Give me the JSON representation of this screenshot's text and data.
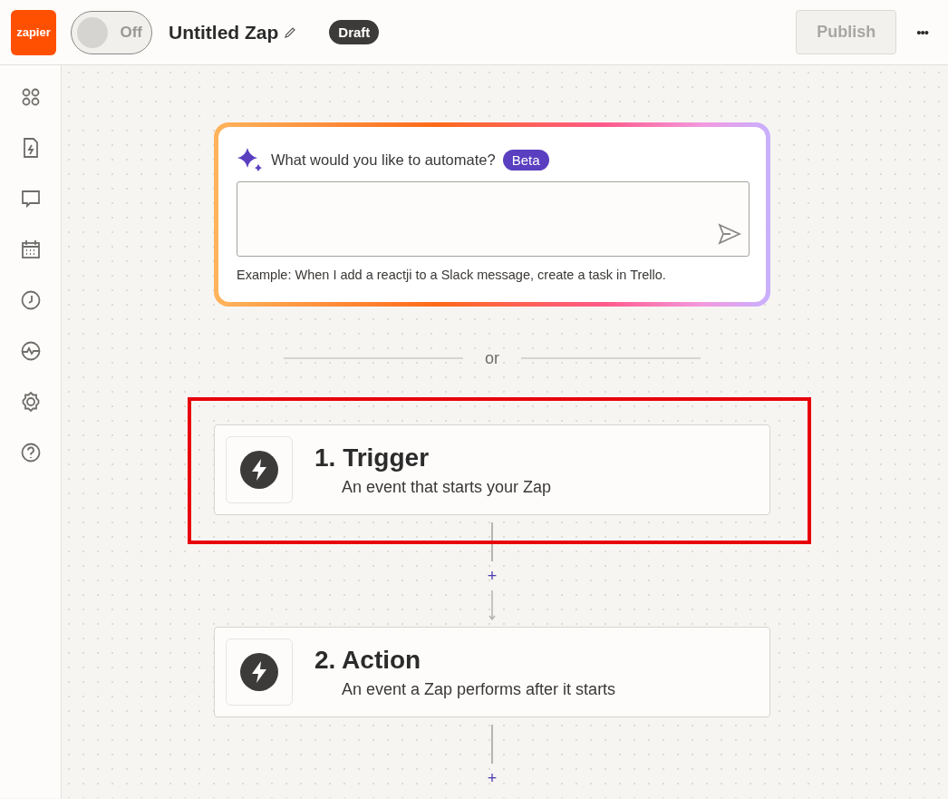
{
  "header": {
    "logo": "zapier",
    "toggle": {
      "label": "Off",
      "on": false
    },
    "title": "Untitled Zap",
    "status_badge": "Draft",
    "publish_button": {
      "label": "Publish",
      "disabled": true
    },
    "more_button": "•••"
  },
  "sidebar": {
    "items": [
      {
        "kind": "apps"
      },
      {
        "kind": "file"
      },
      {
        "kind": "chat"
      },
      {
        "kind": "calendar"
      },
      {
        "kind": "clock"
      },
      {
        "kind": "activity"
      },
      {
        "kind": "settings"
      },
      {
        "kind": "help"
      }
    ]
  },
  "ai_prompt": {
    "question": "What would you like to automate?",
    "badge": "Beta",
    "example": "Example: When I add a reactji to a Slack message, create a task in Trello."
  },
  "separator": "or",
  "steps": [
    {
      "title": "1. Trigger",
      "subtitle": "An event that starts your Zap",
      "highlighted": true
    },
    {
      "title": "2. Action",
      "subtitle": "An event a Zap performs after it starts",
      "highlighted": false
    }
  ],
  "add_step_buttons": [
    "+",
    "+"
  ]
}
